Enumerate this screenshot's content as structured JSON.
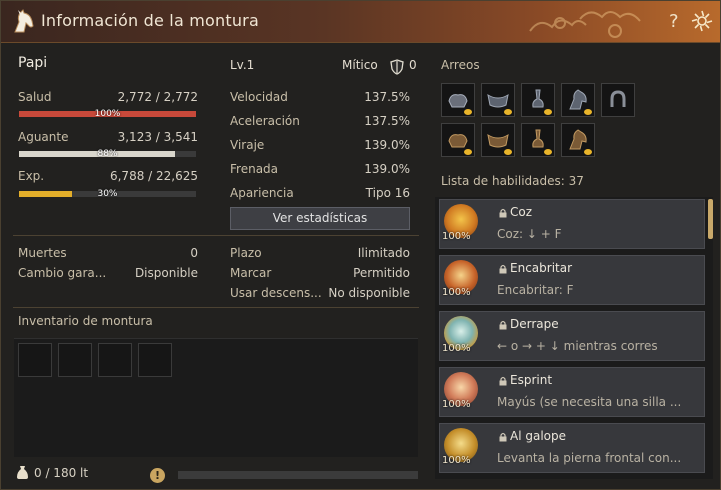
{
  "window": {
    "title": "Información de la montura",
    "help_label": "?"
  },
  "mount": {
    "name": "Papi",
    "level": "Lv.1",
    "grade_label": "Mítico",
    "grade_value": "0"
  },
  "bars": {
    "health": {
      "label": "Salud",
      "value": "2,772 / 2,772",
      "percent": "100%",
      "fill": 1.0,
      "color": "#c8493a"
    },
    "stamina": {
      "label": "Aguante",
      "value": "3,123 / 3,541",
      "percent": "88%",
      "fill": 0.88,
      "color": "#d9d6cc"
    },
    "exp": {
      "label": "Exp.",
      "value": "6,788 / 22,625",
      "percent": "30%",
      "fill": 0.3,
      "color": "#e3ae2a"
    }
  },
  "stats": [
    {
      "label": "Velocidad",
      "value": "137.5%"
    },
    {
      "label": "Aceleración",
      "value": "137.5%"
    },
    {
      "label": "Viraje",
      "value": "139.0%"
    },
    {
      "label": "Frenada",
      "value": "139.0%"
    },
    {
      "label": "Apariencia",
      "value": "Tipo 16"
    }
  ],
  "stats_button": "Ver estadísticas",
  "info_left": [
    {
      "label": "Muertes",
      "value": "0"
    },
    {
      "label": "Cambio gara...",
      "value": "Disponible"
    }
  ],
  "info_right": [
    {
      "label": "Plazo",
      "value": "Ilimitado"
    },
    {
      "label": "Marcar",
      "value": "Permitido"
    },
    {
      "label": "Usar descens...",
      "value": "No disponible"
    }
  ],
  "inventory": {
    "title": "Inventario de montura",
    "weight": "0 / 180 lt"
  },
  "gear": {
    "title": "Arreos"
  },
  "skills": {
    "header": "Lista de habilidades: 37",
    "items": [
      {
        "name": "Coz",
        "desc": "Coz: ↓ + F",
        "pct": "100%",
        "icon": "horse-kick-icon"
      },
      {
        "name": "Encabritar",
        "desc": "Encabritar: F",
        "pct": "100%",
        "icon": "horse-rear-icon"
      },
      {
        "name": "Derrape",
        "desc": "← o → + ↓ mientras corres",
        "pct": "100%",
        "icon": "horse-drift-icon"
      },
      {
        "name": "Esprint",
        "desc": "Mayús (se necesita una silla ...",
        "pct": "100%",
        "icon": "horse-sprint-icon"
      },
      {
        "name": "Al galope",
        "desc": "Levanta la pierna frontal con...",
        "pct": "100%",
        "icon": "horse-gallop-icon"
      }
    ]
  },
  "colors": {
    "title_bar_accent": "#b86a2c",
    "gold": "#e3ae2a"
  }
}
